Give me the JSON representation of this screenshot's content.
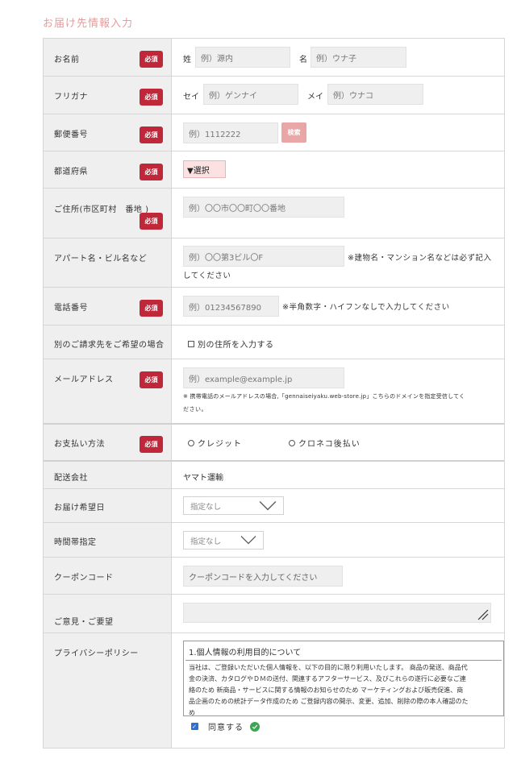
{
  "page_title": "お届け先情報入力",
  "required_label": "必須",
  "name": {
    "label": "お名前",
    "last_label": "姓",
    "last_placeholder": "例）源内",
    "first_label": "名",
    "first_placeholder": "例）ウナ子"
  },
  "kana": {
    "label": "フリガナ",
    "last_label": "セイ",
    "last_placeholder": "例）ゲンナイ",
    "first_label": "メイ",
    "first_placeholder": "例）ウナコ"
  },
  "postal": {
    "label": "郵便番号",
    "placeholder": "例）1112222",
    "search_label": "検索"
  },
  "prefecture": {
    "label": "都道府県",
    "selected": "▼選択"
  },
  "address": {
    "label": "ご住所(市区町村　番地 )",
    "placeholder": "例）〇〇市〇〇町〇〇番地"
  },
  "building": {
    "label": "アパート名・ビル名など",
    "placeholder": "例）〇〇第3ビル〇F",
    "note_1": "※建物名・マンション名などは必ず記入",
    "note_2": "してください"
  },
  "phone": {
    "label": "電話番号",
    "placeholder": "例）01234567890",
    "note": "※半角数字・ハイフンなしで入力してください"
  },
  "billing": {
    "label": "別のご請求先をご希望の場合",
    "checkbox_label": "別の住所を入力する"
  },
  "email": {
    "label": "メールアドレス",
    "placeholder": "例）example@example.jp",
    "note_1": "※ 携帯電話のメールアドレスの場合,「gennaiseiyaku.web-store.jp」こちらのドメインを指定受信してく",
    "note_2": "ださい。"
  },
  "payment": {
    "label": "お支払い方法",
    "option_credit": "クレジット",
    "option_cod": "クロネコ後払い"
  },
  "shipping": {
    "label": "配送会社",
    "value": "ヤマト運輸"
  },
  "delivery_date": {
    "label": "お届け希望日",
    "value": "指定なし"
  },
  "time_slot": {
    "label": "時間帯指定",
    "value": "指定なし"
  },
  "coupon": {
    "label": "クーポンコード",
    "placeholder": "クーポンコードを入力してください"
  },
  "comments": {
    "label": "ご意見・ご要望"
  },
  "privacy": {
    "label": "プライバシーポリシー",
    "heading": "1.個人情報の利用目的について",
    "line_1": "当社は、ご登録いただいた個人情報を、以下の目的に限り利用いたします。 商品の発送、商品代",
    "line_2": "金の決済、カタログやＤＭの送付、関連するアフターサービス、及びこれらの遂行に必要なご連",
    "line_3": "絡のため 新商品・サービスに関する情報のお知らせのため マーケティングおよび販売促進、商",
    "line_4": "品企画のための統計データ作成のため ご登録内容の開示、変更、追加、削除の際の本人確認のた",
    "line_5": "め",
    "agree_label": "同意する"
  },
  "colors": {
    "required_bg": "#c0283a",
    "search_btn_bg": "#e8a6a6",
    "title": "#e89a9a",
    "check": "#2d6fd3",
    "ok": "#3aa64f"
  }
}
